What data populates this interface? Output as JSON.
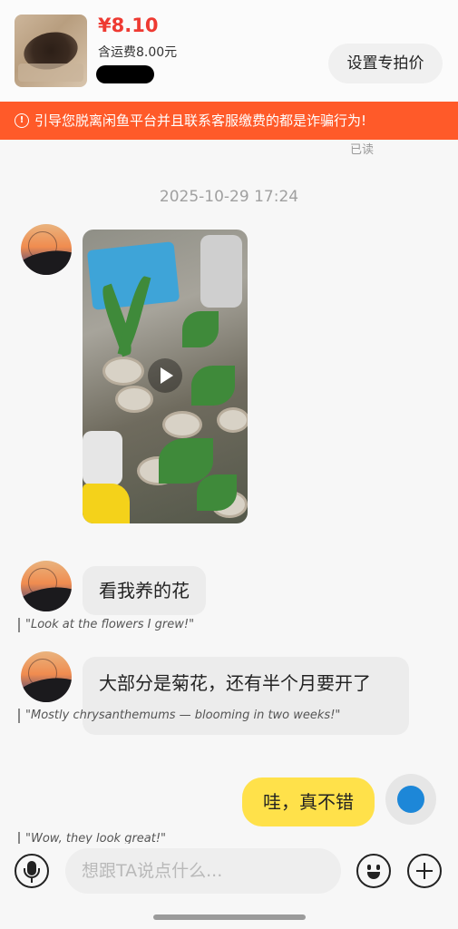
{
  "product": {
    "price": "¥8.10",
    "shipping": "含运费8.00元",
    "set_price_button": "设置专拍价"
  },
  "warning": {
    "text": "引导您脱离闲鱼平台并且联系客服缴费的都是诈骗行为!"
  },
  "read_status": "已读",
  "timestamp": "2025-10-29 17:24",
  "messages": [
    {
      "type": "video",
      "sender": "other"
    },
    {
      "type": "text",
      "sender": "other",
      "text": "看我养的花",
      "translation": "\"Look at the flowers I grew!\""
    },
    {
      "type": "text",
      "sender": "other",
      "text": "大部分是菊花，还有半个月要开了",
      "translation": "\"Mostly chrysanthemums — blooming in two weeks!\""
    },
    {
      "type": "text",
      "sender": "me",
      "text": "哇，真不错",
      "translation": "\"Wow, they look great!\""
    }
  ],
  "input": {
    "placeholder": "想跟TA说点什么..."
  },
  "colors": {
    "price": "#ee3a32",
    "warning_bg": "#ff5a29",
    "my_bubble": "#ffe14a",
    "other_bubble": "#ececec"
  },
  "icons": [
    "alert-icon",
    "play-icon",
    "microphone-icon",
    "emoji-icon",
    "plus-icon"
  ]
}
